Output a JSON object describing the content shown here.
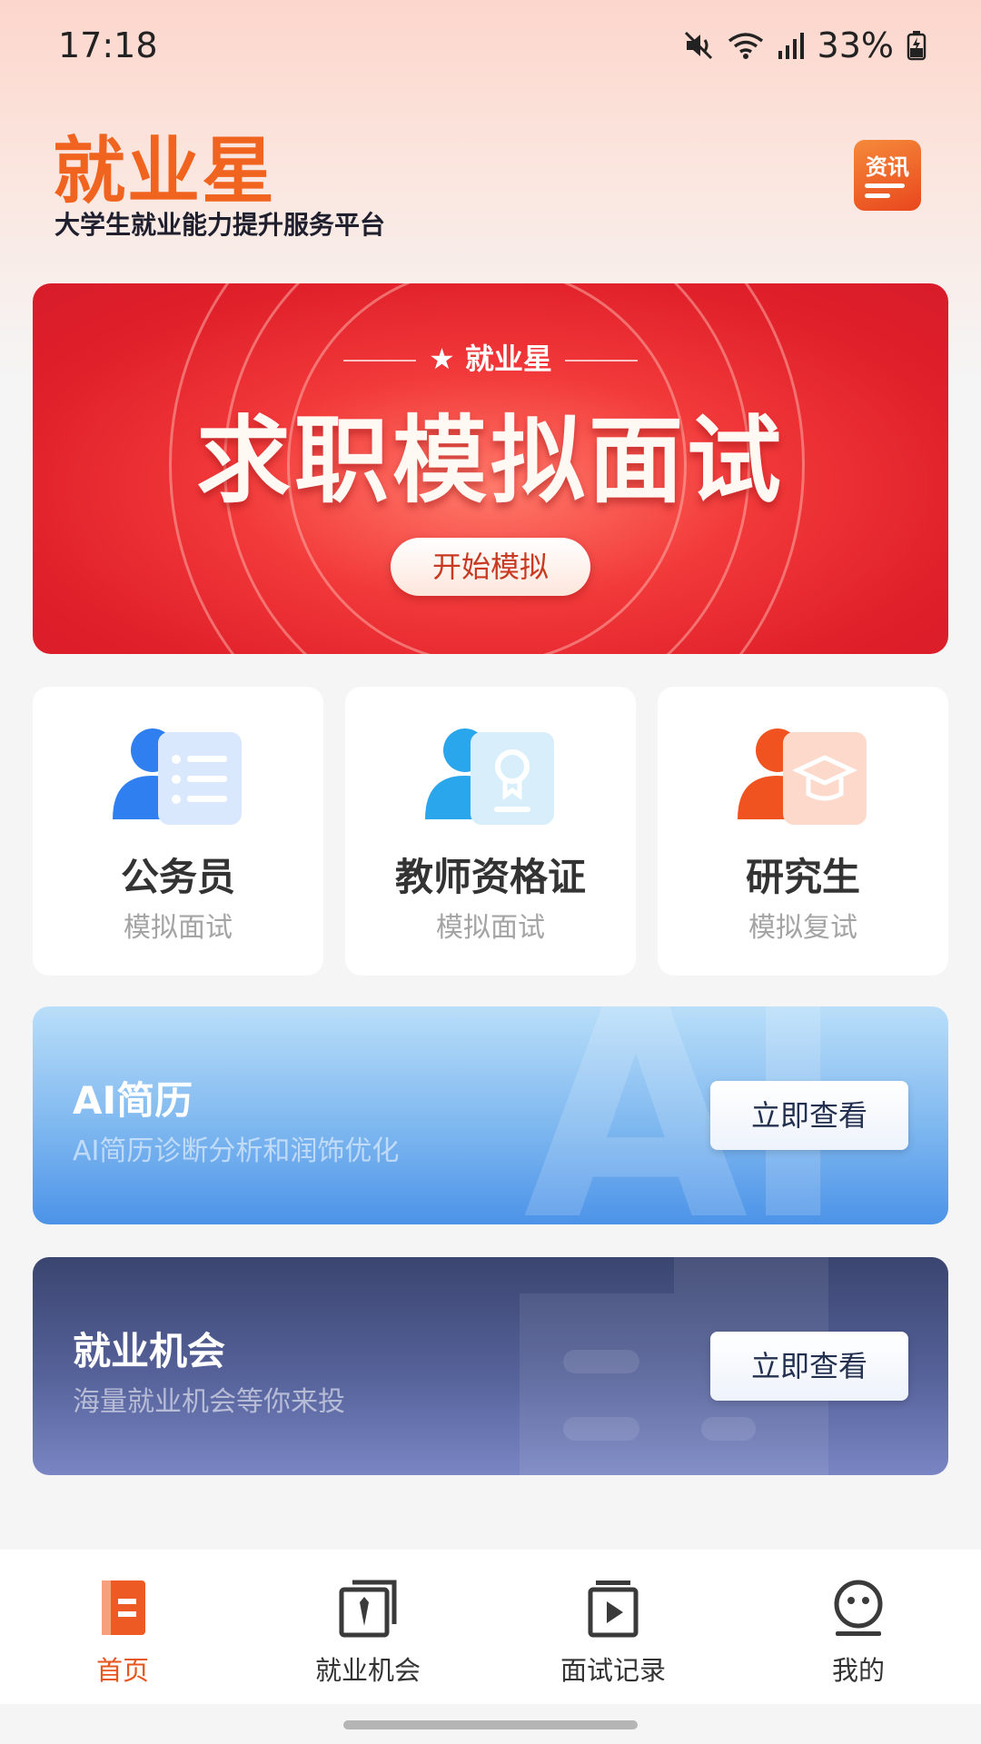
{
  "status_bar": {
    "time": "17:18",
    "battery": "33%"
  },
  "header": {
    "title": "就业星",
    "subtitle": "大学生就业能力提升服务平台",
    "news_label": "资讯"
  },
  "banner": {
    "brand": "就业星",
    "title": "求职模拟面试",
    "button": "开始模拟"
  },
  "cards": [
    {
      "title": "公务员",
      "subtitle": "模拟面试",
      "icon": "civil-servant-icon"
    },
    {
      "title": "教师资格证",
      "subtitle": "模拟面试",
      "icon": "teacher-certificate-icon"
    },
    {
      "title": "研究生",
      "subtitle": "模拟复试",
      "icon": "graduate-cap-icon"
    }
  ],
  "ai_resume": {
    "title": "AI简历",
    "subtitle": "AI简历诊断分析和润饰优化",
    "button": "立即查看",
    "deco": "AI"
  },
  "job_opportunity": {
    "title": "就业机会",
    "subtitle": "海量就业机会等你来投",
    "button": "立即查看"
  },
  "tabs": [
    {
      "label": "首页",
      "icon": "home-icon",
      "active": true
    },
    {
      "label": "就业机会",
      "icon": "briefcase-tie-icon",
      "active": false
    },
    {
      "label": "面试记录",
      "icon": "video-record-icon",
      "active": false
    },
    {
      "label": "我的",
      "icon": "profile-face-icon",
      "active": false
    }
  ],
  "colors": {
    "accent": "#e8551e",
    "banner_red": "#e0202a",
    "ai_blue": "#4c93e8",
    "job_navy": "#3a4570"
  }
}
